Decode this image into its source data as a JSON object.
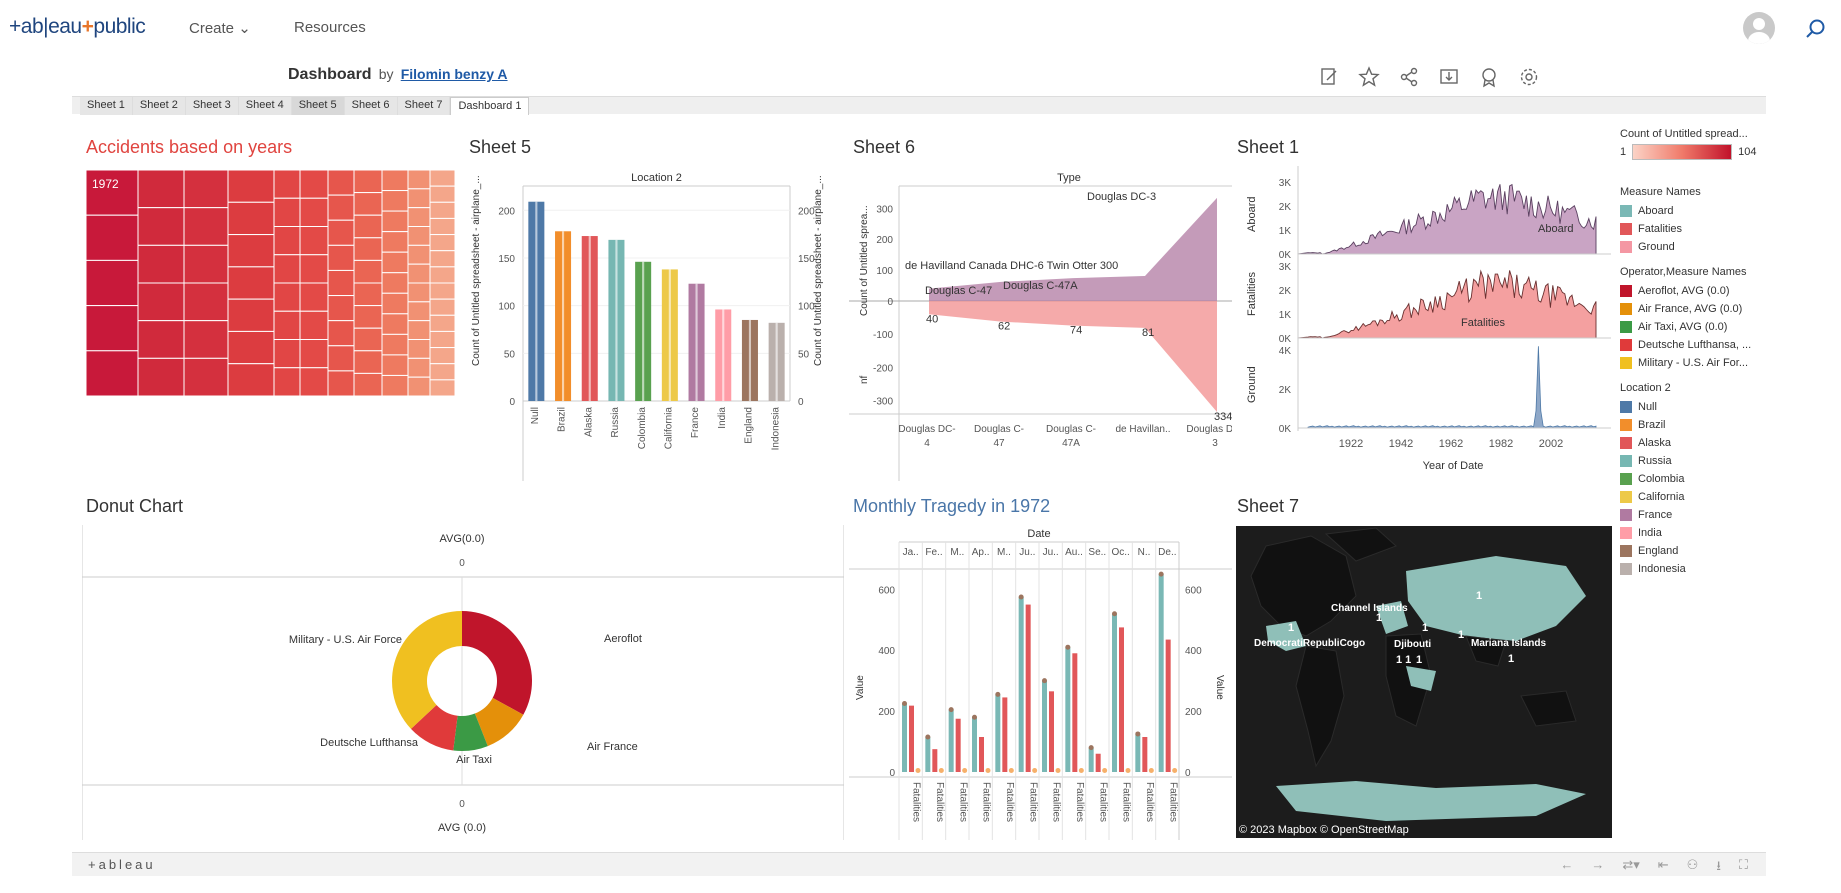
{
  "nav": {
    "create_label": "Create",
    "resources_label": "Resources"
  },
  "header": {
    "title": "Dashboard",
    "by": "by",
    "author": "Filomin benzy A"
  },
  "tabs": [
    "Sheet 1",
    "Sheet 2",
    "Sheet 3",
    "Sheet 4",
    "Sheet 5",
    "Sheet 6",
    "Sheet 7",
    "Dashboard 1"
  ],
  "panels": {
    "treemap_title": "Accidents based on years",
    "treemap_label": "1972",
    "sheet5_title": "Sheet 5",
    "sheet6_title": "Sheet 6",
    "sheet1_title": "Sheet 1",
    "donut_title": "Donut Chart",
    "monthly_title": "Monthly Tragedy in 1972",
    "sheet7_title": "Sheet 7"
  },
  "legend": {
    "count_title": "Count of Untitled spread...",
    "count_min": "1",
    "count_max": "104",
    "measure_title": "Measure Names",
    "measures": [
      {
        "label": "Aboard",
        "color": "#7ab8b5"
      },
      {
        "label": "Fatalities",
        "color": "#e15759"
      },
      {
        "label": "Ground",
        "color": "#f497a3"
      }
    ],
    "operator_title": "Operator,Measure Names",
    "operators": [
      {
        "label": "Aeroflot, AVG (0.0)",
        "color": "#c0152b"
      },
      {
        "label": "Air France, AVG (0.0)",
        "color": "#e4900a"
      },
      {
        "label": "Air Taxi, AVG (0.0)",
        "color": "#3b9a45"
      },
      {
        "label": "Deutsche Lufthansa, ...",
        "color": "#e03a3a"
      },
      {
        "label": "Military - U.S. Air For...",
        "color": "#f0c020"
      }
    ],
    "location_title": "Location 2",
    "locations": [
      {
        "label": "Null",
        "color": "#4e79a7"
      },
      {
        "label": "Brazil",
        "color": "#f28e2b"
      },
      {
        "label": "Alaska",
        "color": "#e15759"
      },
      {
        "label": "Russia",
        "color": "#76b7b2"
      },
      {
        "label": "Colombia",
        "color": "#59a14f"
      },
      {
        "label": "California",
        "color": "#edc948"
      },
      {
        "label": "France",
        "color": "#b07aa1"
      },
      {
        "label": "India",
        "color": "#ff9da7"
      },
      {
        "label": "England",
        "color": "#9c755f"
      },
      {
        "label": "Indonesia",
        "color": "#bab0ac"
      }
    ]
  },
  "footer": {
    "logo": "+ableau"
  },
  "chart_data": [
    {
      "type": "bar",
      "name": "Sheet 5",
      "header": "Location 2",
      "categories": [
        "Null",
        "Brazil",
        "Alaska",
        "Russia",
        "Colombia",
        "California",
        "France",
        "India",
        "England",
        "Indonesia"
      ],
      "values": [
        209,
        178,
        173,
        169,
        146,
        138,
        123,
        96,
        85,
        82
      ],
      "ylabel_left": "Count of Untitled spreadsheet - airplane_...",
      "ylabel_right": "Count of Untitled spreadsheet - airplane_...",
      "yticks": [
        0,
        50,
        100,
        150,
        200
      ],
      "ylim": [
        0,
        215
      ]
    },
    {
      "type": "area",
      "name": "Sheet 6",
      "header": "Type",
      "categories": [
        "Douglas DC-4",
        "Douglas C-47",
        "Douglas C-47A",
        "de Havillan...",
        "Douglas DC-3"
      ],
      "x_tick_labels": [
        "Douglas DC-\n4",
        "Douglas C-\n47",
        "Douglas C-\n47A",
        "de Havillan..",
        "Douglas DC-\n3"
      ],
      "top_values": [
        40,
        62,
        74,
        81,
        334
      ],
      "upper_annotations": [
        "de Havilland Canada DHC-6 Twin Otter 300",
        "Douglas C-47",
        "Douglas C-47A",
        "Douglas DC-3"
      ],
      "ylabel_top": "Count of Untitled sprea...",
      "ylabel_bottom": "nf",
      "yticks_top": [
        0,
        100,
        200,
        300
      ],
      "yticks_bottom": [
        0,
        -100,
        -200,
        -300
      ]
    },
    {
      "type": "area",
      "name": "Sheet 1",
      "xlabel": "Year of Date",
      "x_ticks": [
        "1922",
        "1942",
        "1962",
        "1982",
        "2002"
      ],
      "rows": [
        {
          "name": "Aboard",
          "yticks": [
            "0K",
            "1K",
            "2K",
            "3K"
          ],
          "label": "Aboard"
        },
        {
          "name": "Fatalities",
          "yticks": [
            "0K",
            "1K",
            "2K",
            "3K"
          ],
          "label": "Fatalities"
        },
        {
          "name": "Ground",
          "yticks": [
            "0K",
            "2K",
            "4K"
          ]
        }
      ]
    },
    {
      "type": "pie",
      "name": "Donut Chart",
      "top_label": "AVG(0.0)",
      "top_zero": "0",
      "bottom_zero": "0",
      "bottom_label": "AVG (0.0)",
      "slices": [
        {
          "label": "Aeroflot",
          "value": 33
        },
        {
          "label": "Air France",
          "value": 11
        },
        {
          "label": "Air Taxi",
          "value": 8
        },
        {
          "label": "Deutsche Lufthansa",
          "value": 11
        },
        {
          "label": "Military - U.S. Air Force",
          "value": 37
        }
      ]
    },
    {
      "type": "bar",
      "name": "Monthly Tragedy in 1972",
      "header": "Date",
      "months": [
        "Ja..",
        "Fe..",
        "M..",
        "Ap..",
        "M..",
        "Ju..",
        "Ju..",
        "Au..",
        "Se..",
        "Oc..",
        "N..",
        "De.."
      ],
      "aboard": [
        225,
        115,
        205,
        180,
        255,
        575,
        300,
        410,
        80,
        520,
        125,
        650
      ],
      "fatalities": [
        218,
        75,
        175,
        115,
        245,
        550,
        265,
        390,
        60,
        475,
        115,
        435
      ],
      "ground": [
        5,
        5,
        5,
        5,
        5,
        5,
        5,
        5,
        5,
        5,
        5,
        5
      ],
      "x_label": "Fatalities",
      "ylabel": "Value",
      "yticks": [
        0,
        200,
        400,
        600
      ],
      "ylim": [
        0,
        680
      ]
    }
  ],
  "map": {
    "labels": [
      "Channel Islands",
      "DemocratiRepubliCogo",
      "Djibouti",
      "Mariana Islands"
    ],
    "counts": [
      "1",
      "1",
      "1",
      "1",
      "1",
      "1 1",
      "1",
      "1"
    ],
    "attribution": "© 2023 Mapbox  © OpenStreetMap"
  }
}
